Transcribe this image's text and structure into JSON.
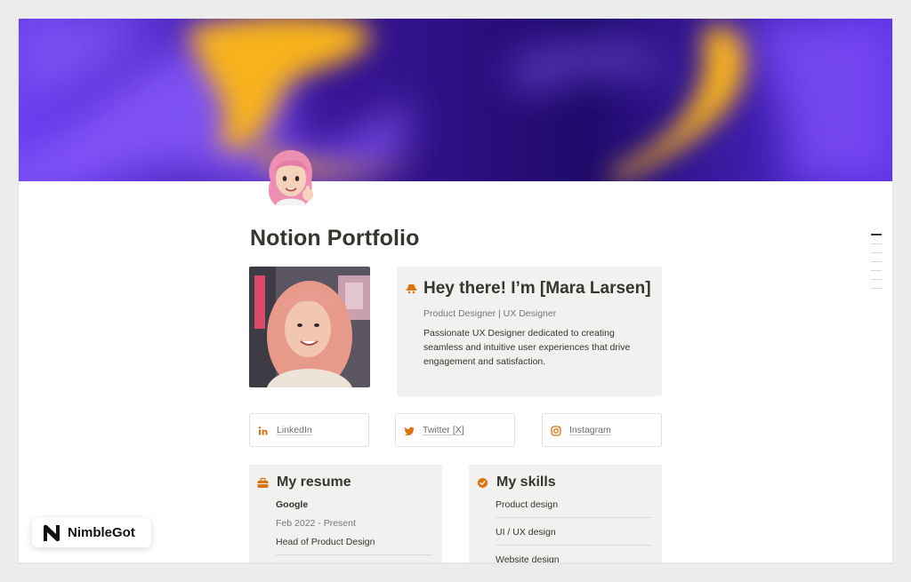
{
  "page": {
    "title": "Notion Portfolio"
  },
  "intro": {
    "heading": "Hey there! I’m [Mara Larsen]",
    "role": "Product Designer | UX Designer",
    "description": "Passionate UX Designer dedicated to creating seamless and intuitive user experiences that drive engagement and satisfaction."
  },
  "social": [
    {
      "label": "LinkedIn",
      "icon": "linkedin-icon"
    },
    {
      "label": "Twitter [X]",
      "icon": "twitter-icon"
    },
    {
      "label": "Instagram",
      "icon": "instagram-icon"
    }
  ],
  "resume": {
    "title": "My resume",
    "icon": "briefcase-icon",
    "company": "Google",
    "dates": "Feb 2022 - Present",
    "role": "Head of Product Design"
  },
  "skills": {
    "title": "My skills",
    "icon": "verified-check-icon",
    "items": [
      "Product design",
      "UI / UX design",
      "Website design"
    ]
  },
  "watermark": {
    "brand": "NimbleGot"
  },
  "colors": {
    "accent_orange": "#d9730d",
    "cover_purple": "#3c1da4",
    "cover_gold": "#f7b21b",
    "card_bg": "#f1f1ef"
  }
}
